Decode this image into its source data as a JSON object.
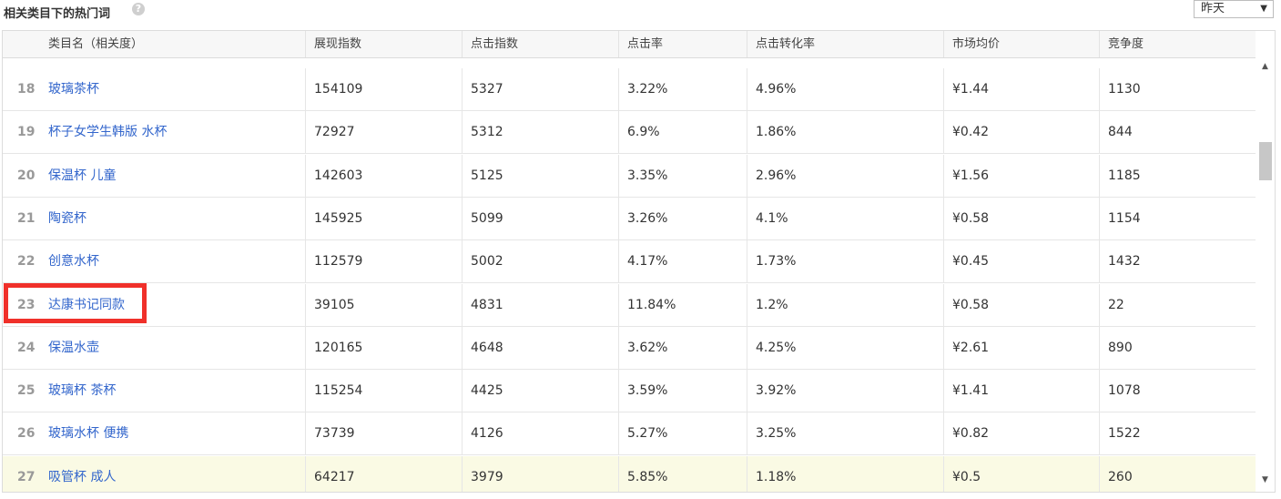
{
  "panel": {
    "title": "相关类目下的热门词",
    "help_icon": "question-icon"
  },
  "date_select": {
    "value": "昨天",
    "arrow": "▼"
  },
  "columns": [
    "类目名（相关度）",
    "展现指数",
    "点击指数",
    "点击率",
    "点击转化率",
    "市场均价",
    "竞争度"
  ],
  "rows": [
    {
      "rank": "18",
      "keyword": "玻璃茶杯",
      "impressions": "154109",
      "clicks": "5327",
      "ctr": "3.22%",
      "cvr": "4.96%",
      "price": "¥1.44",
      "competition": "1130"
    },
    {
      "rank": "19",
      "keyword": "杯子女学生韩版 水杯",
      "impressions": "72927",
      "clicks": "5312",
      "ctr": "6.9%",
      "cvr": "1.86%",
      "price": "¥0.42",
      "competition": "844"
    },
    {
      "rank": "20",
      "keyword": "保温杯 儿童",
      "impressions": "142603",
      "clicks": "5125",
      "ctr": "3.35%",
      "cvr": "2.96%",
      "price": "¥1.56",
      "competition": "1185"
    },
    {
      "rank": "21",
      "keyword": "陶瓷杯",
      "impressions": "145925",
      "clicks": "5099",
      "ctr": "3.26%",
      "cvr": "4.1%",
      "price": "¥0.58",
      "competition": "1154"
    },
    {
      "rank": "22",
      "keyword": "创意水杯",
      "impressions": "112579",
      "clicks": "5002",
      "ctr": "4.17%",
      "cvr": "1.73%",
      "price": "¥0.45",
      "competition": "1432"
    },
    {
      "rank": "23",
      "keyword": "达康书记同款",
      "impressions": "39105",
      "clicks": "4831",
      "ctr": "11.84%",
      "cvr": "1.2%",
      "price": "¥0.58",
      "competition": "22"
    },
    {
      "rank": "24",
      "keyword": "保温水壶",
      "impressions": "120165",
      "clicks": "4648",
      "ctr": "3.62%",
      "cvr": "4.25%",
      "price": "¥2.61",
      "competition": "890"
    },
    {
      "rank": "25",
      "keyword": "玻璃杯 茶杯",
      "impressions": "115254",
      "clicks": "4425",
      "ctr": "3.59%",
      "cvr": "3.92%",
      "price": "¥1.41",
      "competition": "1078"
    },
    {
      "rank": "26",
      "keyword": "玻璃水杯 便携",
      "impressions": "73739",
      "clicks": "4126",
      "ctr": "5.27%",
      "cvr": "3.25%",
      "price": "¥0.82",
      "competition": "1522"
    },
    {
      "rank": "27",
      "keyword": "吸管杯 成人",
      "impressions": "64217",
      "clicks": "3979",
      "ctr": "5.85%",
      "cvr": "1.18%",
      "price": "¥0.5",
      "competition": "260"
    }
  ],
  "highlighted_rank": "23",
  "hover_rank": "27",
  "colors": {
    "link": "#3366cc",
    "highlight_box": "#f0302a",
    "hover_row": "#fafae4"
  },
  "scrollbar": {
    "up": "▲",
    "down": "▼"
  }
}
